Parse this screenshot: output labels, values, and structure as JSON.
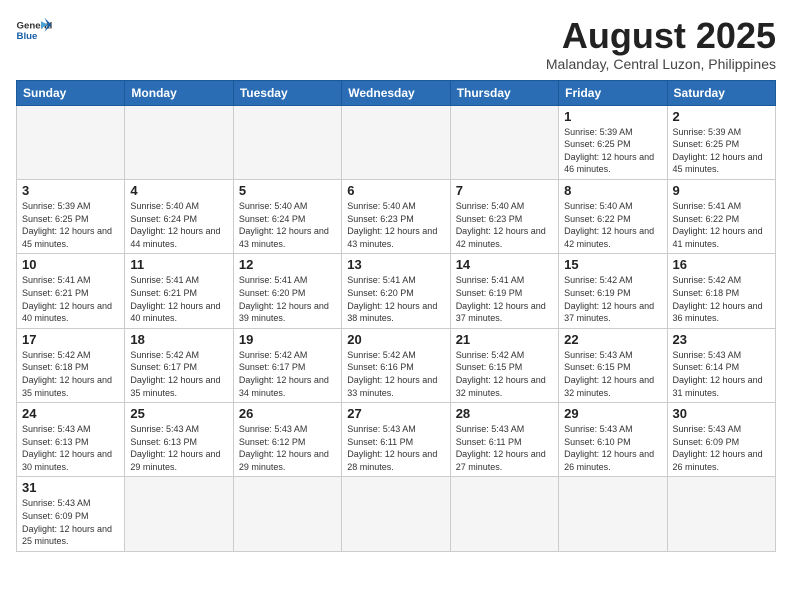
{
  "header": {
    "logo_general": "General",
    "logo_blue": "Blue",
    "month_year": "August 2025",
    "location": "Malanday, Central Luzon, Philippines"
  },
  "weekdays": [
    "Sunday",
    "Monday",
    "Tuesday",
    "Wednesday",
    "Thursday",
    "Friday",
    "Saturday"
  ],
  "weeks": [
    [
      {
        "day": "",
        "info": ""
      },
      {
        "day": "",
        "info": ""
      },
      {
        "day": "",
        "info": ""
      },
      {
        "day": "",
        "info": ""
      },
      {
        "day": "",
        "info": ""
      },
      {
        "day": "1",
        "info": "Sunrise: 5:39 AM\nSunset: 6:25 PM\nDaylight: 12 hours and 46 minutes."
      },
      {
        "day": "2",
        "info": "Sunrise: 5:39 AM\nSunset: 6:25 PM\nDaylight: 12 hours and 45 minutes."
      }
    ],
    [
      {
        "day": "3",
        "info": "Sunrise: 5:39 AM\nSunset: 6:25 PM\nDaylight: 12 hours and 45 minutes."
      },
      {
        "day": "4",
        "info": "Sunrise: 5:40 AM\nSunset: 6:24 PM\nDaylight: 12 hours and 44 minutes."
      },
      {
        "day": "5",
        "info": "Sunrise: 5:40 AM\nSunset: 6:24 PM\nDaylight: 12 hours and 43 minutes."
      },
      {
        "day": "6",
        "info": "Sunrise: 5:40 AM\nSunset: 6:23 PM\nDaylight: 12 hours and 43 minutes."
      },
      {
        "day": "7",
        "info": "Sunrise: 5:40 AM\nSunset: 6:23 PM\nDaylight: 12 hours and 42 minutes."
      },
      {
        "day": "8",
        "info": "Sunrise: 5:40 AM\nSunset: 6:22 PM\nDaylight: 12 hours and 42 minutes."
      },
      {
        "day": "9",
        "info": "Sunrise: 5:41 AM\nSunset: 6:22 PM\nDaylight: 12 hours and 41 minutes."
      }
    ],
    [
      {
        "day": "10",
        "info": "Sunrise: 5:41 AM\nSunset: 6:21 PM\nDaylight: 12 hours and 40 minutes."
      },
      {
        "day": "11",
        "info": "Sunrise: 5:41 AM\nSunset: 6:21 PM\nDaylight: 12 hours and 40 minutes."
      },
      {
        "day": "12",
        "info": "Sunrise: 5:41 AM\nSunset: 6:20 PM\nDaylight: 12 hours and 39 minutes."
      },
      {
        "day": "13",
        "info": "Sunrise: 5:41 AM\nSunset: 6:20 PM\nDaylight: 12 hours and 38 minutes."
      },
      {
        "day": "14",
        "info": "Sunrise: 5:41 AM\nSunset: 6:19 PM\nDaylight: 12 hours and 37 minutes."
      },
      {
        "day": "15",
        "info": "Sunrise: 5:42 AM\nSunset: 6:19 PM\nDaylight: 12 hours and 37 minutes."
      },
      {
        "day": "16",
        "info": "Sunrise: 5:42 AM\nSunset: 6:18 PM\nDaylight: 12 hours and 36 minutes."
      }
    ],
    [
      {
        "day": "17",
        "info": "Sunrise: 5:42 AM\nSunset: 6:18 PM\nDaylight: 12 hours and 35 minutes."
      },
      {
        "day": "18",
        "info": "Sunrise: 5:42 AM\nSunset: 6:17 PM\nDaylight: 12 hours and 35 minutes."
      },
      {
        "day": "19",
        "info": "Sunrise: 5:42 AM\nSunset: 6:17 PM\nDaylight: 12 hours and 34 minutes."
      },
      {
        "day": "20",
        "info": "Sunrise: 5:42 AM\nSunset: 6:16 PM\nDaylight: 12 hours and 33 minutes."
      },
      {
        "day": "21",
        "info": "Sunrise: 5:42 AM\nSunset: 6:15 PM\nDaylight: 12 hours and 32 minutes."
      },
      {
        "day": "22",
        "info": "Sunrise: 5:43 AM\nSunset: 6:15 PM\nDaylight: 12 hours and 32 minutes."
      },
      {
        "day": "23",
        "info": "Sunrise: 5:43 AM\nSunset: 6:14 PM\nDaylight: 12 hours and 31 minutes."
      }
    ],
    [
      {
        "day": "24",
        "info": "Sunrise: 5:43 AM\nSunset: 6:13 PM\nDaylight: 12 hours and 30 minutes."
      },
      {
        "day": "25",
        "info": "Sunrise: 5:43 AM\nSunset: 6:13 PM\nDaylight: 12 hours and 29 minutes."
      },
      {
        "day": "26",
        "info": "Sunrise: 5:43 AM\nSunset: 6:12 PM\nDaylight: 12 hours and 29 minutes."
      },
      {
        "day": "27",
        "info": "Sunrise: 5:43 AM\nSunset: 6:11 PM\nDaylight: 12 hours and 28 minutes."
      },
      {
        "day": "28",
        "info": "Sunrise: 5:43 AM\nSunset: 6:11 PM\nDaylight: 12 hours and 27 minutes."
      },
      {
        "day": "29",
        "info": "Sunrise: 5:43 AM\nSunset: 6:10 PM\nDaylight: 12 hours and 26 minutes."
      },
      {
        "day": "30",
        "info": "Sunrise: 5:43 AM\nSunset: 6:09 PM\nDaylight: 12 hours and 26 minutes."
      }
    ],
    [
      {
        "day": "31",
        "info": "Sunrise: 5:43 AM\nSunset: 6:09 PM\nDaylight: 12 hours and 25 minutes."
      },
      {
        "day": "",
        "info": ""
      },
      {
        "day": "",
        "info": ""
      },
      {
        "day": "",
        "info": ""
      },
      {
        "day": "",
        "info": ""
      },
      {
        "day": "",
        "info": ""
      },
      {
        "day": "",
        "info": ""
      }
    ]
  ]
}
